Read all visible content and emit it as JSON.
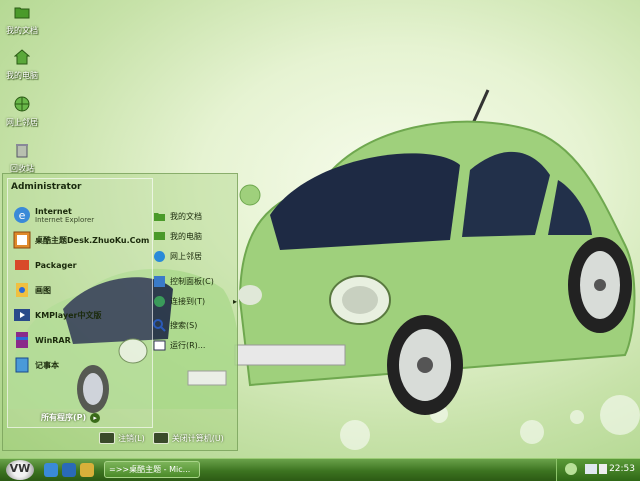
{
  "desktop_icons": [
    {
      "label": "我的文档",
      "icon": "folder-icon"
    },
    {
      "label": "我的电脑",
      "icon": "computer-icon"
    },
    {
      "label": "网上邻居",
      "icon": "network-icon"
    },
    {
      "label": "回收站",
      "icon": "recycle-bin-icon"
    }
  ],
  "start_menu": {
    "user": "Administrator",
    "left_items": [
      {
        "title": "Internet",
        "subtitle": "Internet Explorer",
        "icon": "ie-icon"
      },
      {
        "title": "桌酷主题Desk.ZhuoKu.Com",
        "subtitle": "",
        "icon": "theme-icon"
      },
      {
        "title": "Packager",
        "subtitle": "",
        "icon": "packager-icon"
      },
      {
        "title": "画图",
        "subtitle": "",
        "icon": "paint-icon"
      },
      {
        "title": "KMPlayer中文版",
        "subtitle": "",
        "icon": "kmplayer-icon"
      },
      {
        "title": "WinRAR",
        "subtitle": "",
        "icon": "winrar-icon"
      },
      {
        "title": "记事本",
        "subtitle": "",
        "icon": "notepad-icon"
      }
    ],
    "right_items": [
      {
        "label": "我的文档",
        "icon": "folder-icon"
      },
      {
        "label": "我的电脑",
        "icon": "computer-icon"
      },
      {
        "label": "网上邻居",
        "icon": "network-icon"
      },
      {
        "label": "控制面板(C)",
        "icon": "control-panel-icon"
      },
      {
        "label": "连接到(T)",
        "icon": "connect-icon",
        "arrow": "▸"
      },
      {
        "label": "搜索(S)",
        "icon": "search-icon"
      },
      {
        "label": "运行(R)...",
        "icon": "run-icon"
      }
    ],
    "all_programs": "所有程序(P)",
    "all_programs_arrow": "▸",
    "logoff": "注销(L)",
    "shutdown": "关闭计算机(U)"
  },
  "taskbar": {
    "start_logo": "VW",
    "task": "=>>桌酷主题 - Mic...",
    "clock": "22:53"
  },
  "colors": {
    "accent": "#3c7320",
    "car": "#9fd07c"
  }
}
